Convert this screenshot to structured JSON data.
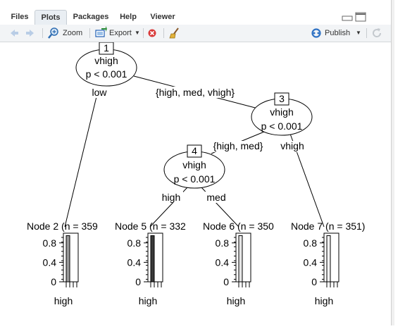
{
  "tabs": [
    {
      "label": "Files",
      "active": false
    },
    {
      "label": "Plots",
      "active": true
    },
    {
      "label": "Packages",
      "active": false
    },
    {
      "label": "Help",
      "active": false
    },
    {
      "label": "Viewer",
      "active": false
    }
  ],
  "toolbar": {
    "zoom_label": "Zoom",
    "export_label": "Export",
    "publish_label": "Publish"
  },
  "tree": {
    "node1": {
      "id": "1",
      "var": "vhigh",
      "p": "p < 0.001"
    },
    "node3": {
      "id": "3",
      "var": "vhigh",
      "p": "p < 0.001"
    },
    "node4": {
      "id": "4",
      "var": "vhigh",
      "p": "p < 0.001"
    },
    "edges": {
      "e1_left": "low",
      "e1_right": "{high, med, vhigh}",
      "e3_left": "{high, med}",
      "e3_right": "vhigh",
      "e4_left": "high",
      "e4_right": "med"
    },
    "terminals": [
      {
        "title": "Node 2 (n = 359",
        "xlabel": "high",
        "proportion": 0.95,
        "fill": "#9a9a9a"
      },
      {
        "title": "Node 5 (n = 332",
        "xlabel": "high",
        "proportion": 0.95,
        "fill": "#3a3a3a"
      },
      {
        "title": "Node 6 (n = 350",
        "xlabel": "high",
        "proportion": 0.95,
        "fill": "#e6e6e6"
      },
      {
        "title": "Node 7 (n = 351)",
        "xlabel": "high",
        "proportion": 0.95,
        "fill": "#f2f2f2"
      }
    ],
    "y_ticks": [
      "0.8",
      "0.4",
      "0"
    ]
  },
  "colors": {
    "publish_blue": "#2f72c4",
    "export_blue": "#1f5fb5",
    "remove_red": "#d93a3a"
  }
}
